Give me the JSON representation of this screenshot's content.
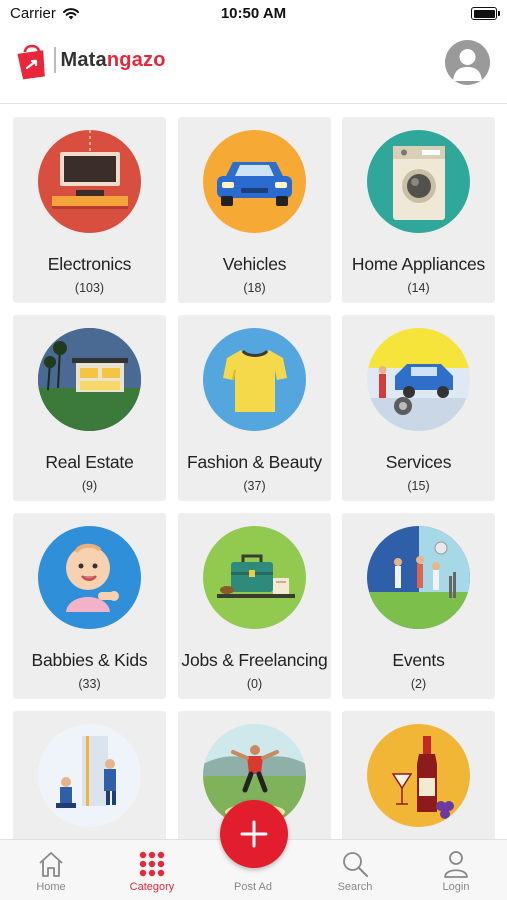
{
  "status_bar": {
    "carrier": "Carrier",
    "time": "10:50 AM"
  },
  "header": {
    "brand_prefix": "Mata",
    "brand_accent": "ngazo"
  },
  "categories": [
    {
      "title": "Electronics",
      "count": "(103)",
      "icon": "tv-cabinet-icon"
    },
    {
      "title": "Vehicles",
      "count": "(18)",
      "icon": "car-icon"
    },
    {
      "title": "Home Appliances",
      "count": "(14)",
      "icon": "washing-machine-icon"
    },
    {
      "title": "Real Estate",
      "count": "(9)",
      "icon": "house-icon"
    },
    {
      "title": "Fashion & Beauty",
      "count": "(37)",
      "icon": "tshirt-icon"
    },
    {
      "title": "Services",
      "count": "(15)",
      "icon": "mechanic-icon"
    },
    {
      "title": "Babbies & Kids",
      "count": "(33)",
      "icon": "baby-icon"
    },
    {
      "title": "Jobs & Freelancing",
      "count": "(0)",
      "icon": "briefcase-icon"
    },
    {
      "title": "Events",
      "count": "(2)",
      "icon": "party-icon"
    },
    {
      "title": "",
      "count": "",
      "icon": "repair-workers-icon"
    },
    {
      "title": "",
      "count": "",
      "icon": "football-player-icon"
    },
    {
      "title": "",
      "count": "",
      "icon": "wine-bottle-icon"
    }
  ],
  "tabs": [
    {
      "label": "Home",
      "icon": "home-icon"
    },
    {
      "label": "Category",
      "icon": "grid-dots-icon",
      "active": true
    },
    {
      "label": "Post Ad",
      "icon": "plus-icon"
    },
    {
      "label": "Search",
      "icon": "search-icon"
    },
    {
      "label": "Login",
      "icon": "user-icon"
    }
  ],
  "colors": {
    "accent": "#e8283a",
    "card_bg": "#eeeeee",
    "tab_inactive": "#888888"
  }
}
